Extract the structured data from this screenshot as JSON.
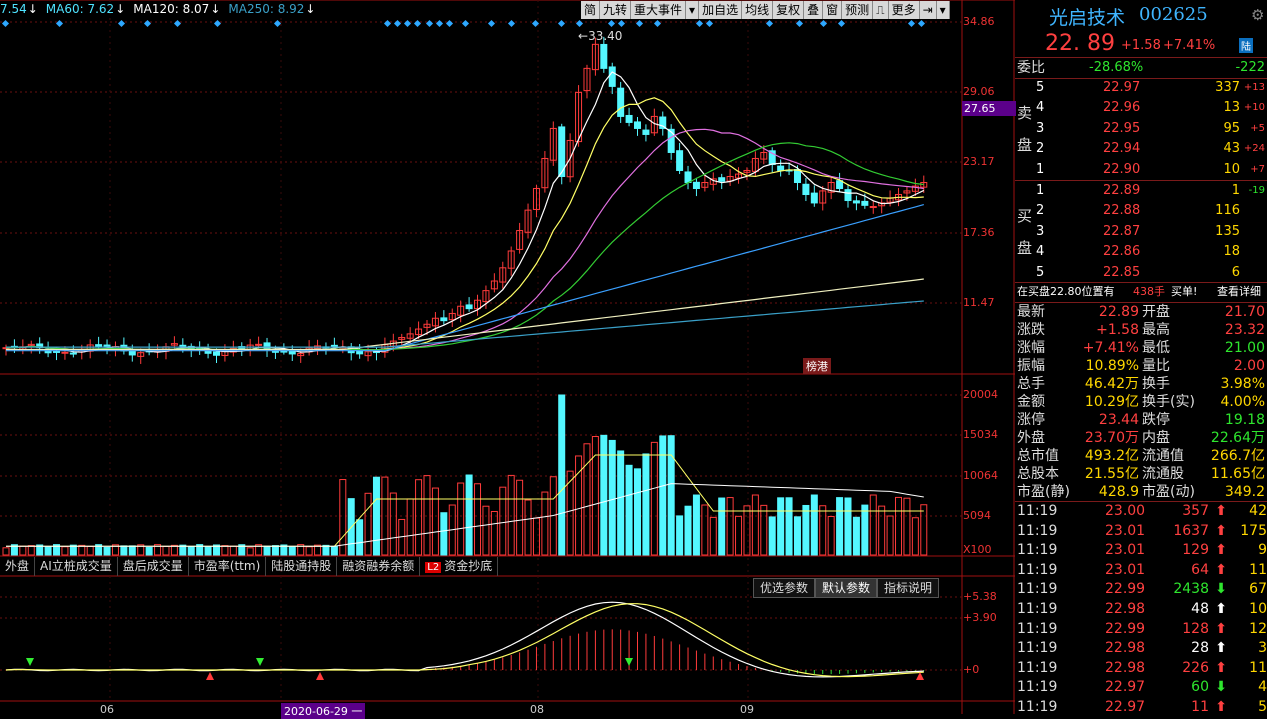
{
  "ma_legend": [
    {
      "label": "7.54",
      "arrow": "↓",
      "color": "#4fe3ff"
    },
    {
      "label": "MA60: 7.62",
      "arrow": "↓",
      "color": "#4fe3ff"
    },
    {
      "label": "MA120: 8.07",
      "arrow": "↓",
      "color": "#ffffff"
    },
    {
      "label": "MA250: 8.92",
      "arrow": "↓",
      "color": "#3aa0c8"
    }
  ],
  "toolbar": [
    "简",
    "九转",
    "重大事件",
    "▾",
    "加自选",
    "均线",
    "复权",
    "叠",
    "窗",
    "预测",
    "⎍",
    "更多",
    "⇥",
    "▾"
  ],
  "price_axis": [
    "34.86",
    "29.06",
    "23.17",
    "17.36",
    "11.47"
  ],
  "price_marker": "27.65",
  "high_label": "33.40",
  "tag_label": "榜港",
  "volume_axis": [
    "20004",
    "15034",
    "10064",
    "5094",
    "X100"
  ],
  "indicator_tabs": [
    "外盘",
    "AI立桩成交量",
    "盘后成交量",
    "市盈率(ttm)",
    "陆股通持股",
    "融资融券余额"
  ],
  "indicator_tab_l2": {
    "badge": "L2",
    "label": "资金抄底"
  },
  "param_buttons": [
    "优选参数",
    "默认参数",
    "指标说明"
  ],
  "macd_axis": [
    "+5.38",
    "+3.90",
    "+0"
  ],
  "x_axis": [
    "06",
    "2020-06-29 一",
    "08",
    "09"
  ],
  "stock": {
    "name": "光启技术",
    "code": "002625",
    "price": "22. 89",
    "change": "+1.58",
    "pct": "+7.41%",
    "badge": "陆"
  },
  "weibi": {
    "label": "委比",
    "pct": "-28.68%",
    "diff": "-222"
  },
  "sell_label": [
    "卖",
    "盘"
  ],
  "buy_label": [
    "买",
    "盘"
  ],
  "sells": [
    {
      "lv": "5",
      "price": "22.97",
      "vol": "337",
      "chg": "+13"
    },
    {
      "lv": "4",
      "price": "22.96",
      "vol": "13",
      "chg": "+10"
    },
    {
      "lv": "3",
      "price": "22.95",
      "vol": "95",
      "chg": "+5"
    },
    {
      "lv": "2",
      "price": "22.94",
      "vol": "43",
      "chg": "+24"
    },
    {
      "lv": "1",
      "price": "22.90",
      "vol": "10",
      "chg": "+7"
    }
  ],
  "buys": [
    {
      "lv": "1",
      "price": "22.89",
      "vol": "1",
      "chg": "-19"
    },
    {
      "lv": "2",
      "price": "22.88",
      "vol": "116",
      "chg": ""
    },
    {
      "lv": "3",
      "price": "22.87",
      "vol": "135",
      "chg": ""
    },
    {
      "lv": "4",
      "price": "22.86",
      "vol": "18",
      "chg": ""
    },
    {
      "lv": "5",
      "price": "22.85",
      "vol": "6",
      "chg": ""
    }
  ],
  "notice": {
    "text": "在买盘22.80位置有",
    "qty": "438手",
    "action": "买单!",
    "link": "查看详细"
  },
  "quote": [
    [
      "最新",
      "22.89",
      "开盘",
      "21.70"
    ],
    [
      "涨跌",
      "+1.58",
      "最高",
      "23.32"
    ],
    [
      "涨幅",
      "+7.41%",
      "最低",
      "21.00"
    ],
    [
      "振幅",
      "10.89%",
      "量比",
      "2.00"
    ],
    [
      "总手",
      "46.42万",
      "换手",
      "3.98%"
    ],
    [
      "金额",
      "10.29亿",
      "换手(实)",
      "4.00%"
    ],
    [
      "涨停",
      "23.44",
      "跌停",
      "19.18"
    ],
    [
      "外盘",
      "23.70万",
      "内盘",
      "22.64万"
    ],
    [
      "总市值",
      "493.2亿",
      "流通值",
      "266.7亿"
    ],
    [
      "总股本",
      "21.55亿",
      "流通股",
      "11.65亿"
    ],
    [
      "市盈(静)",
      "428.9",
      "市盈(动)",
      "349.2"
    ]
  ],
  "ticks": [
    {
      "t": "11:19",
      "p": "23.00",
      "v": "357",
      "d": "up",
      "n": "42"
    },
    {
      "t": "11:19",
      "p": "23.01",
      "v": "1637",
      "d": "up",
      "n": "175"
    },
    {
      "t": "11:19",
      "p": "23.01",
      "v": "129",
      "d": "up",
      "n": "9"
    },
    {
      "t": "11:19",
      "p": "23.01",
      "v": "64",
      "d": "up",
      "n": "11"
    },
    {
      "t": "11:19",
      "p": "22.99",
      "v": "2438",
      "d": "down",
      "n": "67"
    },
    {
      "t": "11:19",
      "p": "22.98",
      "v": "48",
      "d": "upw",
      "n": "10"
    },
    {
      "t": "11:19",
      "p": "22.99",
      "v": "128",
      "d": "up",
      "n": "12"
    },
    {
      "t": "11:19",
      "p": "22.98",
      "v": "28",
      "d": "upw",
      "n": "3"
    },
    {
      "t": "11:19",
      "p": "22.98",
      "v": "226",
      "d": "up",
      "n": "11"
    },
    {
      "t": "11:19",
      "p": "22.97",
      "v": "60",
      "d": "down",
      "n": "4"
    },
    {
      "t": "11:19",
      "p": "22.97",
      "v": "11",
      "d": "up",
      "n": "5"
    }
  ]
}
